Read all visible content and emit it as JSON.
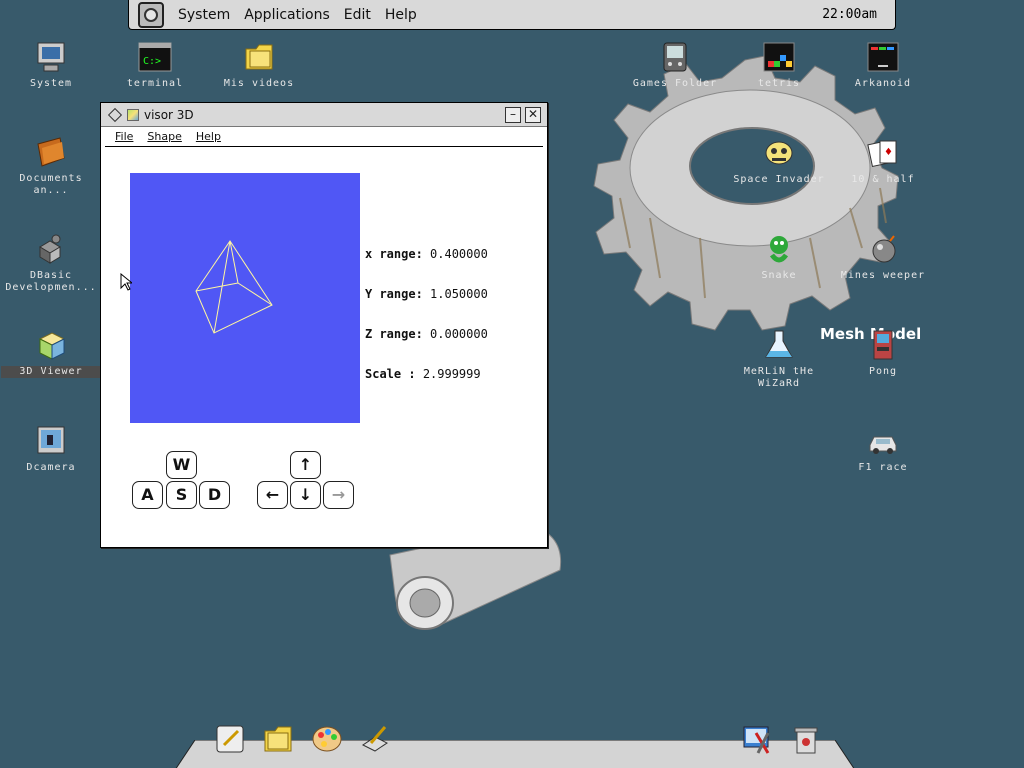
{
  "menubar": {
    "items": [
      "System",
      "Applications",
      "Edit",
      "Help"
    ],
    "clock": "22:00am"
  },
  "desktop_icons_left": [
    {
      "label": "System",
      "icon": "computer-icon"
    },
    {
      "label": "terminal",
      "icon": "terminal-icon"
    },
    {
      "label": "Mis videos",
      "icon": "folder-icon"
    },
    {
      "label": "Documents an...",
      "icon": "folder-icon"
    },
    {
      "label": "DBasic Developmen...",
      "icon": "shapes-icon"
    },
    {
      "label": "3D Viewer",
      "icon": "cube-icon"
    },
    {
      "label": "Dcamera",
      "icon": "camera-icon"
    }
  ],
  "desktop_icons_right": [
    {
      "label": "Games Folder",
      "icon": "games-folder-icon"
    },
    {
      "label": "tetris",
      "icon": "tetris-icon"
    },
    {
      "label": "Arkanoid",
      "icon": "arkanoid-icon"
    },
    {
      "label": "Space Invader",
      "icon": "space-invader-icon"
    },
    {
      "label": "10 & half",
      "icon": "cards-icon"
    },
    {
      "label": "Snake",
      "icon": "snake-icon"
    },
    {
      "label": "Mines weeper",
      "icon": "bomb-icon"
    },
    {
      "label": "MeRLiN tHe WiZaRd",
      "icon": "flask-icon"
    },
    {
      "label": "Pong",
      "icon": "arcade-icon"
    },
    {
      "label": "F1 race",
      "icon": "car-icon"
    }
  ],
  "mesh_label": "Mesh Model",
  "window": {
    "title": "visor 3D",
    "menu": [
      "File",
      "Shape",
      "Help"
    ],
    "readouts": [
      {
        "key": "x range:",
        "value": "0.400000"
      },
      {
        "key": "Y range:",
        "value": "1.050000"
      },
      {
        "key": "Z range:",
        "value": "0.000000"
      },
      {
        "key": "Scale  :",
        "value": "2.999999"
      }
    ],
    "keys_wasd": [
      "W",
      "A",
      "S",
      "D"
    ],
    "keys_arrows": [
      "↑",
      "←",
      "↓",
      "→"
    ],
    "viewport_color": "#5057f5"
  },
  "dock": {
    "icons": [
      "text-editor-icon",
      "folder-icon",
      "paint-palette-icon",
      "sketch-icon",
      "tools-icon",
      "trash-icon"
    ]
  }
}
